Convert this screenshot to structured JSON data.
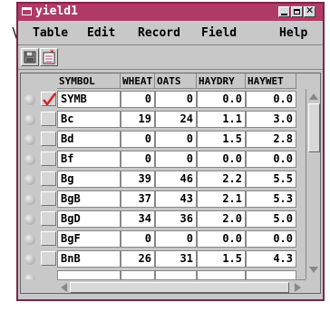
{
  "window": {
    "title": "yield1"
  },
  "menu": [
    {
      "label": "Table"
    },
    {
      "label": "Edit"
    },
    {
      "label": "Record"
    },
    {
      "label": "Field"
    },
    {
      "label": "Help"
    }
  ],
  "table": {
    "columns": [
      "SYMBOL",
      "WHEAT",
      "OATS",
      "HAYDRY",
      "HAYWET"
    ],
    "rows": [
      [
        "SYMB",
        "0",
        "0",
        "0.0",
        "0.0"
      ],
      [
        "Bc",
        "19",
        "24",
        "1.1",
        "3.0"
      ],
      [
        "Bd",
        "0",
        "0",
        "1.5",
        "2.8"
      ],
      [
        "Bf",
        "0",
        "0",
        "0.0",
        "0.0"
      ],
      [
        "Bg",
        "39",
        "46",
        "2.2",
        "5.5"
      ],
      [
        "BgB",
        "37",
        "43",
        "2.1",
        "5.3"
      ],
      [
        "BgD",
        "34",
        "36",
        "2.0",
        "5.0"
      ],
      [
        "BgF",
        "0",
        "0",
        "0.0",
        "0.0"
      ],
      [
        "BnB",
        "26",
        "31",
        "1.5",
        "4.3"
      ]
    ]
  },
  "colors": {
    "titlebar": "#b03a66",
    "check": "#e02020"
  }
}
